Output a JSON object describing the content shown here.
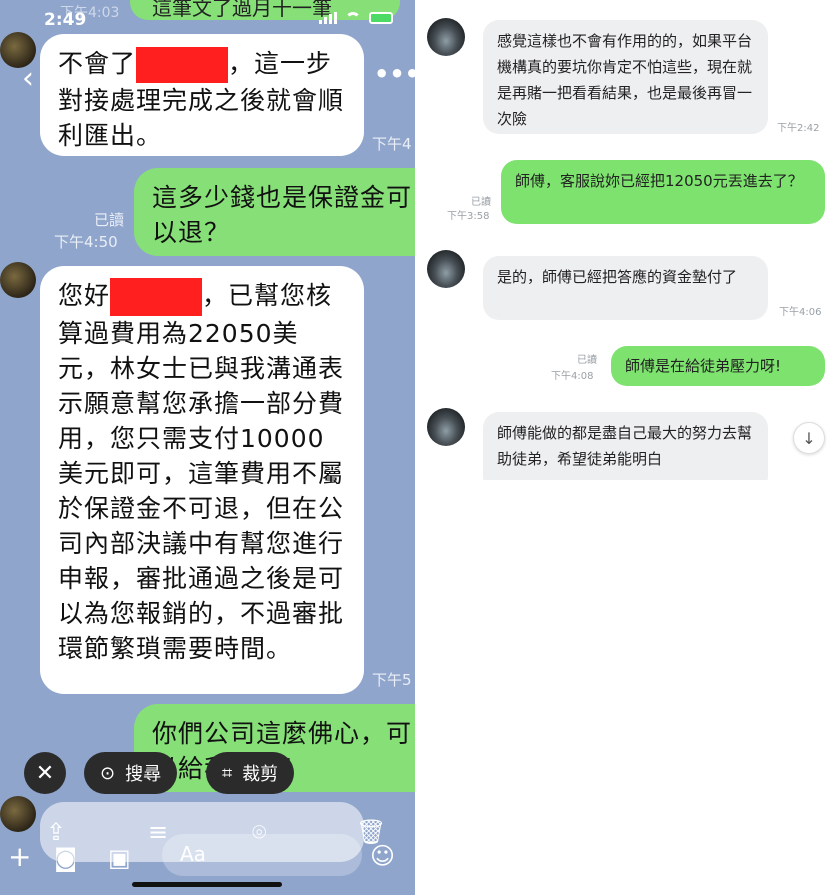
{
  "left_phone": {
    "status": {
      "time": "2:49"
    },
    "top_partial_text": "這筆文了過月十一筆",
    "ghost_time": "下午4:03",
    "messages": [
      {
        "text_before": "不會了",
        "text_after": "，這一步對接處理完成之後就會順利匯出。",
        "time": "下午4"
      },
      {
        "text": "這多少錢也是保證金可以退？",
        "read": "已讀",
        "time": "下午4:50"
      },
      {
        "text_before": "您好",
        "text_after": "，已幫您核算過費用為22050美元，林女士已與我溝通表示願意幫您承擔一部分費用，您只需支付10000美元即可，這筆費用不屬於保證金不可退，但在公司內部決議中有幫您進行申報，審批通過之後是可以為您報銷的，不過審批環節繁瑣需要時間。",
        "time": "下午5"
      },
      {
        "text": "你們公司這麼佛心，可以給我報銷！"
      }
    ],
    "actions": {
      "search_label": "搜尋",
      "crop_label": "裁剪"
    },
    "input_placeholder": "Aa"
  },
  "right_chat": {
    "messages": [
      {
        "side": "left",
        "text": "感覺這樣也不會有作用的的，如果平台機構真的要坑你肯定不怕這些，現在就是再賭一把看看結果，也是最後再冒一次險",
        "time": "下午2:42"
      },
      {
        "side": "right",
        "text": "師傅，客服說妳已經把12050元丟進去了？",
        "read": "已讀",
        "time": "下午3:58"
      },
      {
        "side": "left",
        "text": "是的，師傅已經把答應的資金墊付了",
        "time": "下午4:06"
      },
      {
        "side": "right",
        "text": "師傅是在給徒弟壓力呀!",
        "read": "已讀",
        "time": "下午4:08"
      },
      {
        "side": "left",
        "text": "師傅能做的都是盡自己最大的努力去幫助徒弟，希望徒弟能明白"
      }
    ]
  },
  "colors": {
    "left_bg": "#8fa5cc",
    "bubble_green": "#86df77",
    "redaction": "#ff1f1f",
    "right_green": "#7de36e",
    "right_gray": "#eeeff1"
  }
}
